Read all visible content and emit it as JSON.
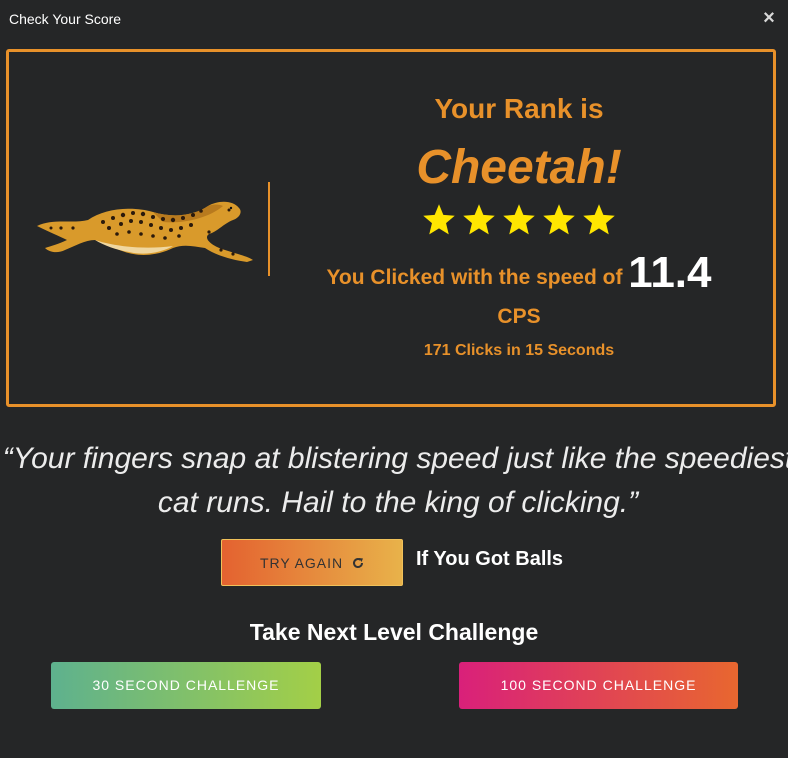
{
  "header": {
    "title": "Check Your Score",
    "close_icon": "close-icon"
  },
  "result": {
    "rank_label": "Your Rank is",
    "rank_name": "Cheetah!",
    "stars": 5,
    "star_color": "#ffe600",
    "speed_prefix": "You Clicked with the speed of",
    "speed_value": "11.4",
    "speed_unit": "CPS",
    "clicks_summary": "171 Clicks in 15 Seconds",
    "image_icon": "cheetah-image"
  },
  "quote": {
    "line1": "“Your fingers snap at blistering speed just like the speediest",
    "line2": "cat runs. Hail to the king of clicking.”"
  },
  "actions": {
    "try_again_label": "TRY AGAIN",
    "refresh_icon": "refresh-icon",
    "balls_text": "If You Got Balls",
    "next_heading": "Take Next Level Challenge",
    "challenge_30_label": "30 SECOND CHALLENGE",
    "challenge_100_label": "100 SECOND CHALLENGE"
  },
  "colors": {
    "accent": "#e8912a",
    "background": "#252627"
  }
}
